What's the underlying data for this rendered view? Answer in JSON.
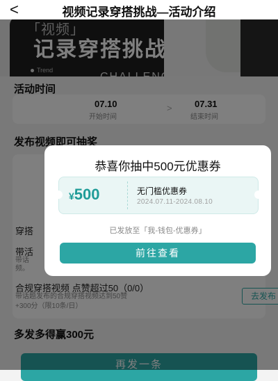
{
  "header": {
    "back_icon": "chevron-left-icon",
    "back_glyph": "<",
    "title": "视频记录穿搭挑战—活动介绍"
  },
  "banner": {
    "quote_text": "「视频」",
    "title": "记录穿搭挑战",
    "trend": "Trend",
    "challenge": "CHALLENGE"
  },
  "activity_time": {
    "heading": "活动时间",
    "start_date": "07.10",
    "start_label": "开始时间",
    "separator": ">",
    "end_date": "07.31",
    "end_label": "结束时间"
  },
  "publish": {
    "heading": "发布视频即可抽奖"
  },
  "tasks": {
    "row1_title": "穿搭",
    "row2_title": "带活",
    "row2_sub1": "带话",
    "row2_sub2": "频。",
    "row3_title": "合规穿搭视频 点赞超过50（0/0）",
    "row3_sub1": "带话题发布的合规穿搭视频达到50赞",
    "row3_sub2": "+300分（限10条/日）",
    "go_button": "去发布"
  },
  "footer": {
    "more_text": "多发多得赢300元",
    "again_button": "再发一条"
  },
  "modal": {
    "title": "恭喜你抽中500元优惠券",
    "coupon_currency": "¥",
    "coupon_amount": "500",
    "coupon_name": "无门槛优惠券",
    "coupon_date": "2024.07.11-2024.08.10",
    "note": "已发放至「我-钱包-优惠券」",
    "button": "前往查看"
  },
  "colors": {
    "accent": "#2ca6a4",
    "coupon_bg": "#eaf6f5",
    "overlay": "rgba(0,0,0,0.5)"
  }
}
